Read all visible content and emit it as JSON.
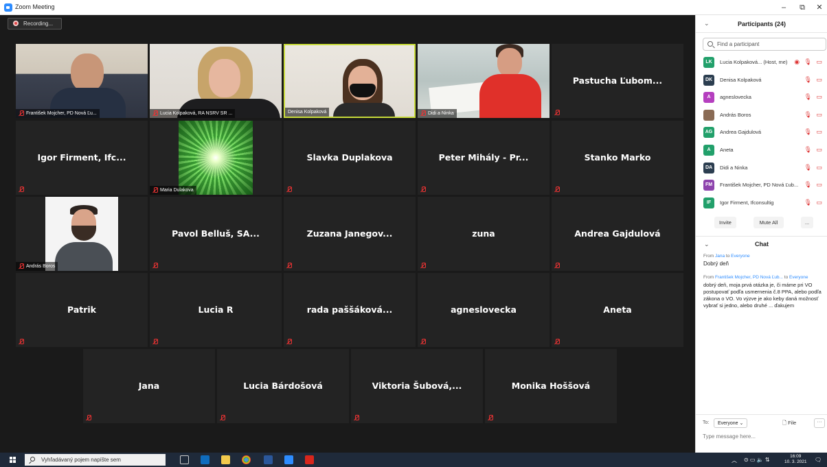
{
  "window": {
    "title": "Zoom Meeting",
    "minimize": "–",
    "restore": "⧉",
    "close": "✕"
  },
  "recording": {
    "label": "Recording..."
  },
  "tiles": [
    {
      "name": "František Mojcher, PD Nová Ľu...",
      "kind": "video",
      "photo": "ph1"
    },
    {
      "name": "Lucia Kolpaková, RA NSRV SR ...",
      "kind": "video",
      "photo": "ph2"
    },
    {
      "name": "Denisa Kolpaková",
      "kind": "video",
      "photo": "ph3",
      "active": true,
      "unmuted": true
    },
    {
      "name": "Didi a Ninka",
      "kind": "video",
      "photo": "ph4"
    },
    {
      "name": "Pastucha Ľubom...",
      "kind": "text"
    },
    {
      "name": "Igor Firment, Ifc...",
      "kind": "text"
    },
    {
      "name": "Maria Dulakova",
      "kind": "video",
      "photo": "starburst"
    },
    {
      "name": "Slavka Duplakova",
      "kind": "text"
    },
    {
      "name": "Peter Mihály - Pr...",
      "kind": "text"
    },
    {
      "name": "Stanko Marko",
      "kind": "text"
    },
    {
      "name": "András Boros",
      "kind": "video",
      "photo": "ph5"
    },
    {
      "name": "Pavol Belluš, SA...",
      "kind": "text"
    },
    {
      "name": "Zuzana Janegov...",
      "kind": "text"
    },
    {
      "name": "zuna",
      "kind": "text"
    },
    {
      "name": "Andrea Gajdulová",
      "kind": "text"
    },
    {
      "name": "Patrik",
      "kind": "text"
    },
    {
      "name": "Lucia R",
      "kind": "text"
    },
    {
      "name": "rada paššáková...",
      "kind": "text"
    },
    {
      "name": "agneslovecka",
      "kind": "text"
    },
    {
      "name": "Aneta",
      "kind": "text"
    },
    {
      "name": "Jana",
      "kind": "text"
    },
    {
      "name": "Lucia Bárdošová",
      "kind": "text"
    },
    {
      "name": "Viktoria Šubová,...",
      "kind": "text"
    },
    {
      "name": "Monika Hoššová",
      "kind": "text"
    }
  ],
  "participants_panel": {
    "title": "Participants (24)",
    "search_placeholder": "Find a participant",
    "items": [
      {
        "initials": "LK",
        "color": "#22a06b",
        "name": "Lucia Kolpaková... (Host, me)",
        "icons": "◉ 🎙 ▭"
      },
      {
        "initials": "DK",
        "color": "#2c3e50",
        "name": "Denisa Kolpaková",
        "icons": "🎙 ▭"
      },
      {
        "initials": "A",
        "color": "#b53fbf",
        "name": "agneslovecka",
        "icons": "🎙 ▭"
      },
      {
        "initials": "",
        "color": "#8a6b55",
        "name": "András Boros",
        "icons": "🎙 ▭"
      },
      {
        "initials": "AG",
        "color": "#22a06b",
        "name": "Andrea Gajdulová",
        "icons": "🎙 ▭"
      },
      {
        "initials": "A",
        "color": "#22a06b",
        "name": "Aneta",
        "icons": "🎙 ▭"
      },
      {
        "initials": "DA",
        "color": "#2c3e50",
        "name": "Didi a Ninka",
        "icons": "🎙 ▭"
      },
      {
        "initials": "FM",
        "color": "#8e44ad",
        "name": "František Mojcher, PD Nová Ľub...",
        "icons": "🎙 ▭"
      },
      {
        "initials": "IF",
        "color": "#22a06b",
        "name": "Igor Firment, Ifconsultig",
        "icons": "🎙 ▭"
      }
    ],
    "buttons": {
      "invite": "Invite",
      "mute_all": "Mute All",
      "more": "..."
    }
  },
  "chat": {
    "title": "Chat",
    "messages": [
      {
        "from": "Jana",
        "to": "Everyone",
        "text": "Dobrý deň"
      },
      {
        "from": "František Mojcher, PD Nová Ľub...",
        "to": "Everyone",
        "text": "dobrý deň, moja prvá otázka je, či máme pri VO postupovať podľa usmernenia č.8 PPA, alebo podľa zákona o VO. Vo výzve je ako keby daná možnosť vybrať si jedno, alebo druhé ... ďakujem"
      }
    ],
    "composer": {
      "to_label": "To:",
      "recipient": "Everyone ⌄",
      "file_label": "File",
      "more": "···",
      "placeholder": "Type message here..."
    }
  },
  "taskbar": {
    "search_placeholder": "Vyhľadávaný pojem napíšte sem",
    "time": "16:09",
    "date": "10. 3. 2021"
  }
}
